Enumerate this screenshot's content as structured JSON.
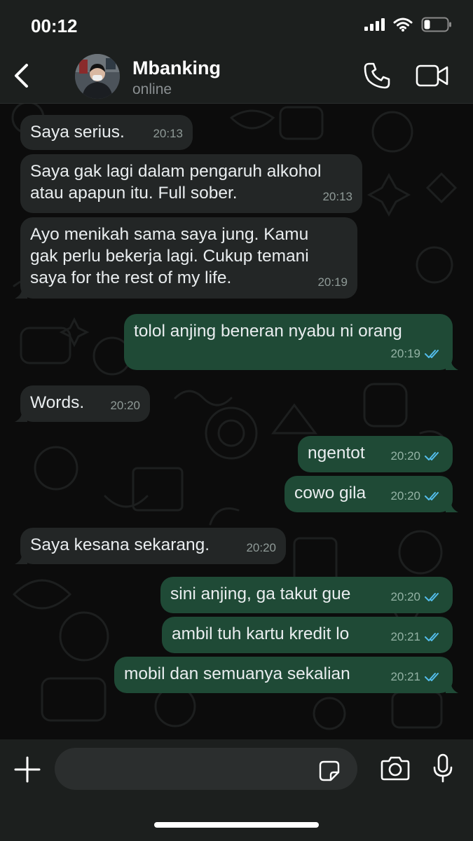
{
  "status_bar": {
    "time": "00:12",
    "icons": [
      "signal-icon",
      "wifi-icon",
      "battery-icon"
    ]
  },
  "header": {
    "back_icon": "chevron-left-icon",
    "contact_name": "Mbanking",
    "contact_status": "online",
    "actions": [
      "phone-icon",
      "video-camera-icon"
    ]
  },
  "messages": [
    {
      "direction": "in",
      "text": "Saya serius.",
      "time": "20:13"
    },
    {
      "direction": "in",
      "text": "Saya gak lagi dalam pengaruh alkohol\natau apapun itu. Full sober.",
      "time": "20:13"
    },
    {
      "direction": "in",
      "text": "Ayo menikah sama saya jung. Kamu\ngak perlu bekerja lagi. Cukup temani\nsaya for the rest of my life.",
      "time": "20:19"
    },
    {
      "direction": "out",
      "text": "tolol anjing beneran nyabu ni orang",
      "time": "20:19",
      "read": true
    },
    {
      "direction": "in",
      "text": "Words.",
      "time": "20:20"
    },
    {
      "direction": "out",
      "text": "ngentot",
      "time": "20:20",
      "read": true
    },
    {
      "direction": "out",
      "text": "cowo gila",
      "time": "20:20",
      "read": true
    },
    {
      "direction": "in",
      "text": "Saya kesana sekarang.",
      "time": "20:20"
    },
    {
      "direction": "out",
      "text": "sini anjing, ga takut gue",
      "time": "20:20",
      "read": true
    },
    {
      "direction": "out",
      "text": "ambil tuh kartu kredit lo",
      "time": "20:21",
      "read": true
    },
    {
      "direction": "out",
      "text": "mobil dan semuanya sekalian",
      "time": "20:21",
      "read": true
    }
  ],
  "input_bar": {
    "message_value": "",
    "icons": [
      "plus-icon",
      "sticker-icon",
      "camera-icon",
      "microphone-icon"
    ]
  },
  "colors": {
    "incoming_bubble": "#232626",
    "outgoing_bubble": "#1f4a36",
    "read_ticks": "#53bdeb",
    "bar_background": "#1c1f1e"
  }
}
